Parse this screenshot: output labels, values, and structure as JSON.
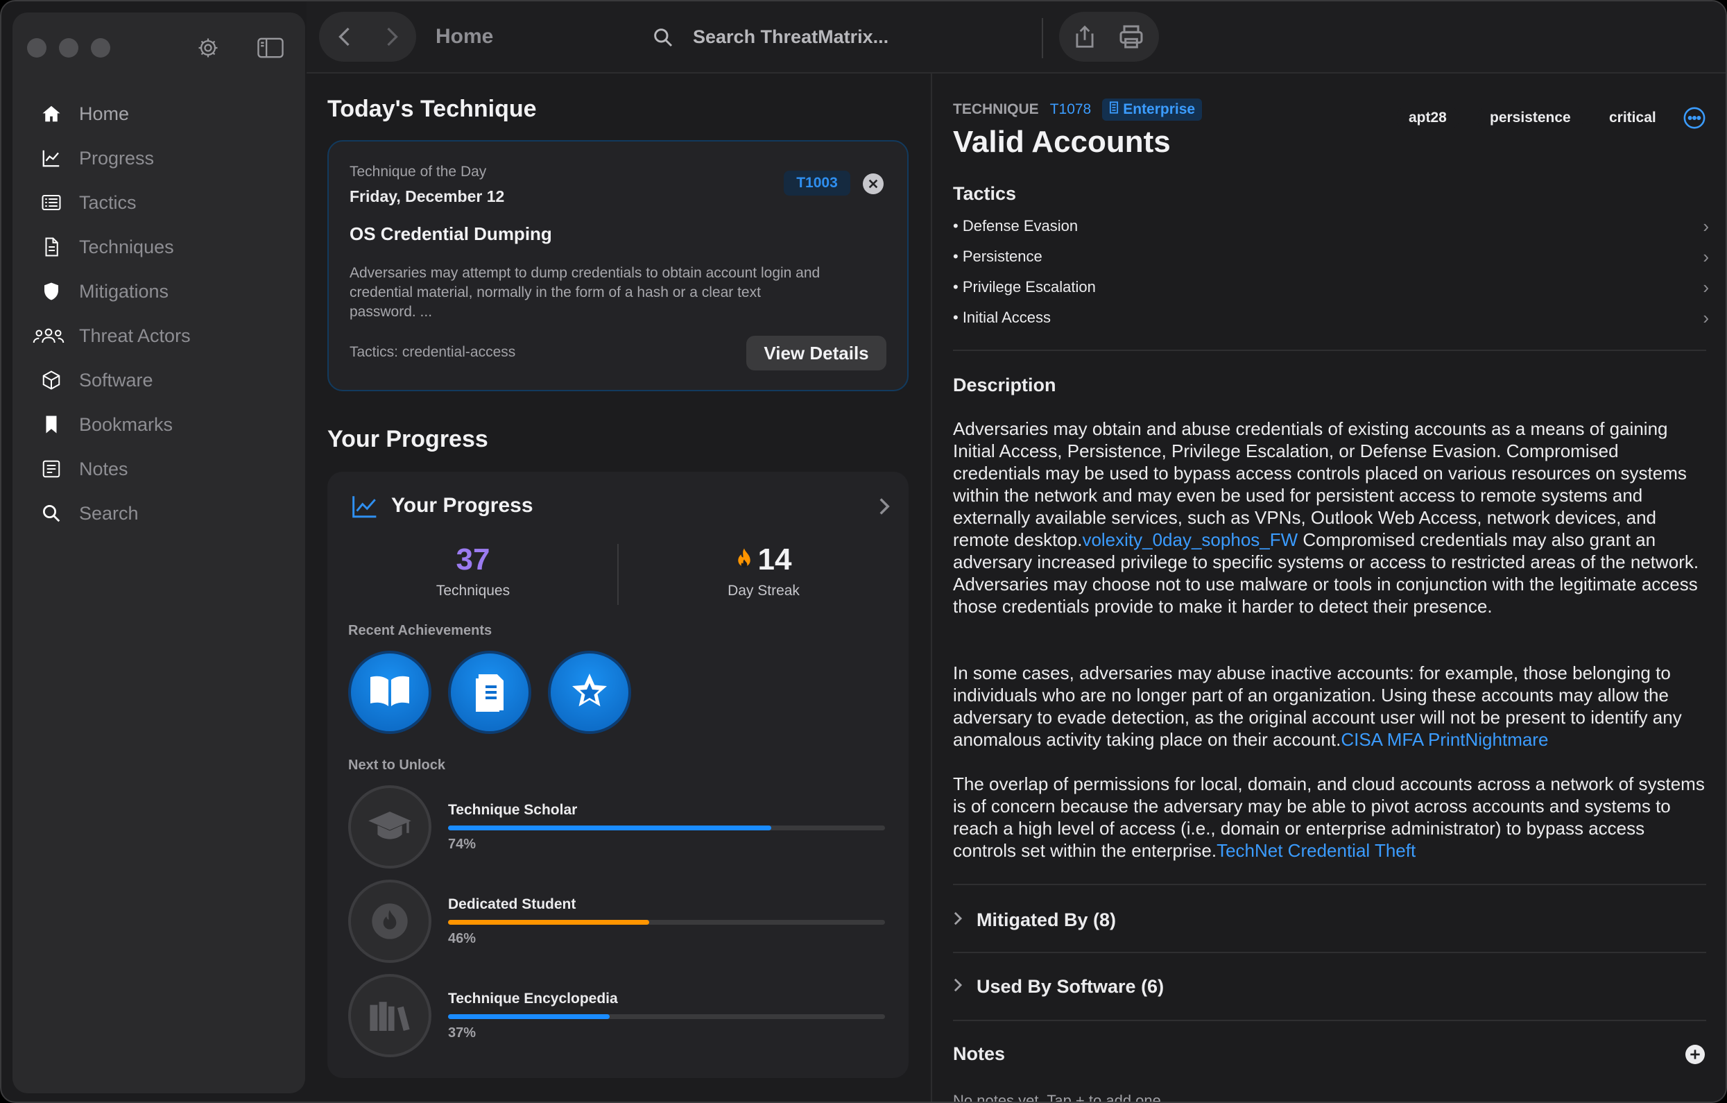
{
  "toolbar": {
    "title": "Home",
    "search_placeholder": "Search ThreatMatrix..."
  },
  "sidebar": {
    "items": [
      {
        "label": "Home",
        "icon": "house-icon"
      },
      {
        "label": "Progress",
        "icon": "chart-line-icon"
      },
      {
        "label": "Tactics",
        "icon": "list-icon"
      },
      {
        "label": "Techniques",
        "icon": "document-icon"
      },
      {
        "label": "Mitigations",
        "icon": "shield-icon"
      },
      {
        "label": "Threat Actors",
        "icon": "people-icon"
      },
      {
        "label": "Software",
        "icon": "cube-icon"
      },
      {
        "label": "Bookmarks",
        "icon": "bookmark-icon"
      },
      {
        "label": "Notes",
        "icon": "notes-icon"
      },
      {
        "label": "Search",
        "icon": "search-icon"
      }
    ]
  },
  "today": {
    "heading": "Today's Technique",
    "card_label": "Technique of the Day",
    "date": "Friday, December 12",
    "technique_id": "T1003",
    "title": "OS Credential Dumping",
    "description_l1": "Adversaries may attempt to dump credentials to obtain account login and",
    "description_l2": "credential material, normally in the form of a hash or a clear text",
    "description_l3": "password. ...",
    "tactics": "Tactics: credential-access",
    "view_details": "View Details"
  },
  "progress": {
    "heading": "Your Progress",
    "card_title": "Your Progress",
    "techniques_count": "37",
    "techniques_label": "Techniques",
    "streak_count": "14",
    "streak_label": "Day Streak",
    "recent_label": "Recent Achievements",
    "achievements": [
      "book-icon",
      "document-icon",
      "star-icon"
    ],
    "next_label": "Next to Unlock",
    "unlocks": [
      {
        "name": "Technique Scholar",
        "percent_label": "74%",
        "value": 0.74,
        "color": "#1a8cff",
        "icon": "graduation-cap-icon"
      },
      {
        "name": "Dedicated Student",
        "percent_label": "46%",
        "value": 0.46,
        "color": "#ff9500",
        "icon": "flame-icon"
      },
      {
        "name": "Technique Encyclopedia",
        "percent_label": "37%",
        "value": 0.37,
        "color": "#1a8cff",
        "icon": "books-icon"
      }
    ]
  },
  "detail": {
    "kind": "TECHNIQUE",
    "id": "T1078",
    "platform": "Enterprise",
    "title": "Valid Accounts",
    "tags": [
      "apt28",
      "persistence",
      "critical"
    ],
    "tactics_heading": "Tactics",
    "tactics": [
      "• Defense Evasion",
      "• Persistence",
      "• Privilege Escalation",
      "• Initial Access"
    ],
    "description_heading": "Description",
    "para1_text": "Adversaries may obtain and abuse credentials of existing accounts as a means of gaining Initial Access, Persistence, Privilege Escalation, or Defense Evasion. Compromised credentials may be used to bypass access controls placed on various resources on systems within the network and may even be used for persistent access to remote systems and externally available services, such as VPNs, Outlook Web Access, network devices, and remote desktop.",
    "para1_link": "volexity_0day_sophos_FW",
    "para1_tail": " Compromised credentials may also grant an adversary increased privilege to specific systems or access to restricted areas of the network. Adversaries may choose not to use malware or tools in conjunction with the legitimate access those credentials provide to make it harder to detect their presence.",
    "para2_text": "In some cases, adversaries may abuse inactive accounts: for example, those belonging to individuals who are no longer part of an organization. Using these accounts may allow the adversary to evade detection, as the original account user will not be present to identify any anomalous activity taking place on their account.",
    "para2_link": "CISA MFA PrintNightmare",
    "para3_text": "The overlap of permissions for local, domain, and cloud accounts across a network of systems is of concern because the adversary may be able to pivot across accounts and systems to reach a high level of access (i.e., domain or enterprise administrator) to bypass access controls set within the enterprise.",
    "para3_link": "TechNet Credential Theft",
    "mitigated_by": "Mitigated By (8)",
    "used_by_software": "Used By Software (6)",
    "notes_heading": "Notes",
    "notes_empty": "No notes yet. Tap + to add one."
  },
  "colors": {
    "accent": "#3b9cff",
    "streak": "#ff9500"
  }
}
